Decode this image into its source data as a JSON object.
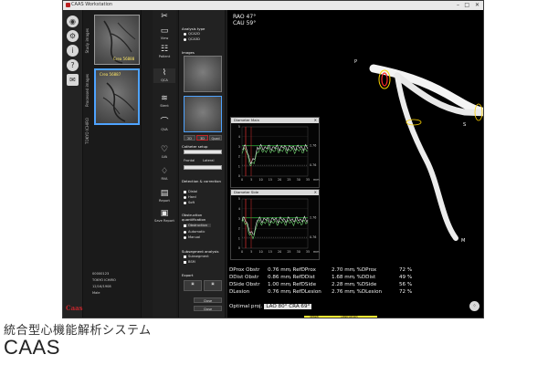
{
  "window": {
    "title": "CAAS Workstation",
    "controls": [
      "–",
      "□",
      "✕"
    ]
  },
  "iconbar": {
    "icons": [
      "view-icon",
      "settings-icon",
      "info-icon",
      "help-icon",
      "mail-icon"
    ],
    "logo": "Caas"
  },
  "patient": {
    "thumbnails": [
      {
        "label": "Crea 56888",
        "selected": false
      },
      {
        "label": "Crea 56887",
        "selected": true
      }
    ],
    "vertical_labels": [
      "Study images",
      "Processed images",
      "TOKYO ICHIRO"
    ],
    "info_lines": [
      "00000123",
      "TOKYO ICHIRO",
      "12/16/1908",
      "Male"
    ]
  },
  "tools": [
    {
      "icon": "tools-icon",
      "label": ""
    },
    {
      "icon": "view-icon",
      "label": "View"
    },
    {
      "icon": "patient-icon",
      "label": "Patient"
    },
    {
      "icon": "qca-icon",
      "label": "QCA"
    },
    {
      "icon": "stent-icon",
      "label": "Stent"
    },
    {
      "icon": "qvA-icon",
      "label": "QVA"
    },
    {
      "icon": "lva-icon",
      "label": "LVA"
    },
    {
      "icon": "rva-icon",
      "label": "RVA"
    },
    {
      "icon": "report-icon",
      "label": "Report"
    },
    {
      "icon": "save-report-icon",
      "label": "Save Report"
    }
  ],
  "qca_panel": {
    "analysis_type_label": "Analysis type",
    "analysis_types": [
      "QCA2D",
      "QCA3D"
    ],
    "images_label": "Images",
    "view_buttons": [
      "2D",
      "3D",
      "Quad"
    ],
    "catheter_label": "Catheter setup",
    "catheter_fields": [
      "Frontal",
      "Lateral"
    ],
    "detection_label": "Detection & correction",
    "detection_options": [
      "Distal",
      "Hard",
      "Soft"
    ],
    "obstruction_label": "Obstruction quantification",
    "obstruction_check": "Obstruction",
    "obstruction_modes": [
      "Automatic",
      "Manual"
    ],
    "subsegment_label": "Subsegment analysis",
    "subsegment_options": [
      "Subsegment",
      "BSM"
    ],
    "export_label": "Export",
    "close_buttons": [
      "Close",
      "Close"
    ]
  },
  "viewer": {
    "rao": "RAO 47°",
    "cau": "CAU 59°",
    "landmarks": {
      "p": "P",
      "s": "S",
      "m": "M"
    },
    "panel_main_title": "Diameter Main",
    "panel_side_title": "Diameter Side",
    "panel_y_ticks": [
      "5",
      "4",
      "3",
      "2",
      "1",
      "0"
    ],
    "panel_main_x_ticks": [
      "0",
      "5",
      "10",
      "15",
      "20",
      "25",
      "30",
      "35"
    ],
    "panel_side_x_ticks": [
      "0",
      "5",
      "10",
      "15",
      "20",
      "25",
      "30",
      "35"
    ],
    "panel_refs_main": [
      "2.76",
      "0.76"
    ],
    "panel_refs_side": [
      "2.76",
      "0.76"
    ],
    "panel_main_unit": "mm",
    "panel_side_unit": "mm",
    "stats": [
      {
        "name": "DProx Obstr",
        "obs": "0.76 mm",
        "refname": ", RefDProx",
        "ref": "2.70 mm",
        "pct_label": ", %DProx",
        "pct": "72 %"
      },
      {
        "name": "DDist Obstr",
        "obs": "0.86 mm",
        "refname": ", RefDDist",
        "ref": "1.68 mm",
        "pct_label": ", %DDist",
        "pct": "49 %"
      },
      {
        "name": "DSide Obstr",
        "obs": "1.00 mm",
        "refname": ", RefDSide",
        "ref": "2.28 mm",
        "pct_label": ", %DSide",
        "pct": "56 %"
      },
      {
        "name": "DLesion",
        "obs": "0.76 mm",
        "refname": ", RefDLesion",
        "ref": "2.76 mm",
        "pct_label": ", %DLesion",
        "pct": "72 %"
      }
    ],
    "optimal_label": "Optimal proj.",
    "optimal_value": "LAO 80° CRA 69°",
    "strip_labels": [
      "Vessel",
      "Obstruction"
    ]
  },
  "caption": {
    "japanese": "統合型心機能解析システム",
    "english": "CAAS"
  },
  "colors": {
    "accent_blue": "#4ea3ff",
    "logo_red": "#c0262c",
    "marker_yellow": "#ffef33"
  }
}
